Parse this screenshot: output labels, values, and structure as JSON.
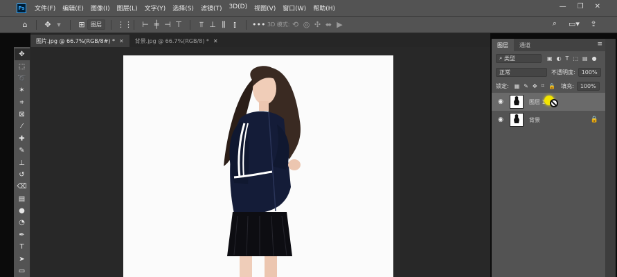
{
  "app": {
    "logo_text": "Ps"
  },
  "menu": [
    "文件(F)",
    "编辑(E)",
    "图像(I)",
    "图层(L)",
    "文字(Y)",
    "选择(S)",
    "滤镜(T)",
    "3D(D)",
    "视图(V)",
    "窗口(W)",
    "帮助(H)"
  ],
  "window_controls": {
    "minimize": "—",
    "restore": "❐",
    "close": "✕"
  },
  "options": {
    "layer_select": "图层",
    "mode_3d": "3D 模式:"
  },
  "tabs": [
    {
      "label": "图片.jpg @ 66.7%(RGB/8#) *",
      "close": "✕"
    },
    {
      "label": "背景.jpg @ 66.7%(RGB/8) *",
      "close": "✕"
    }
  ],
  "panel": {
    "tab_layers": "图层",
    "tab_channels": "通道",
    "kind_filter": "类型",
    "blend_mode": "正常",
    "opacity_label": "不透明度:",
    "opacity_value": "100%",
    "lock_label": "锁定:",
    "fill_label": "填充:",
    "fill_value": "100%",
    "layers": [
      {
        "name": "图层 1",
        "selected": true
      },
      {
        "name": "背景",
        "locked": true
      }
    ]
  },
  "colors": {
    "chrome": "#535353",
    "canvas_bg": "#282828",
    "accent": "#31a8ff",
    "cursor_highlight": "#f3e500"
  },
  "icons": {
    "home": "home-icon",
    "move": "move-icon",
    "search": "search-icon",
    "workspace": "workspace-icon",
    "share": "share-icon"
  }
}
